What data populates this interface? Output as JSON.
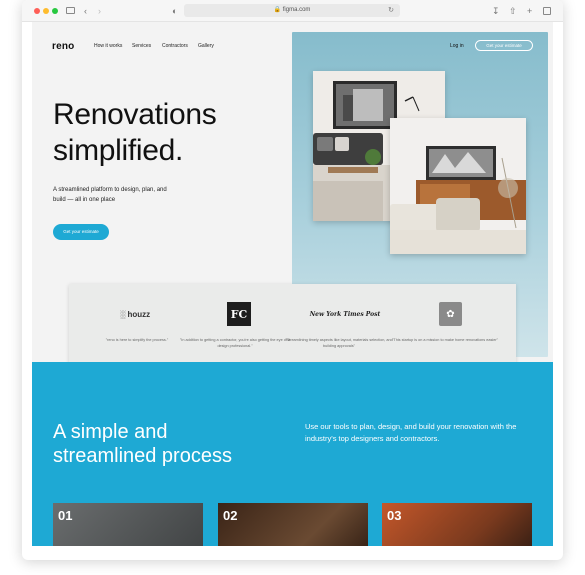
{
  "browser": {
    "url": "figma.com"
  },
  "nav": {
    "logo": "reno",
    "links": [
      "How it works",
      "Services",
      "Contractors",
      "Gallery"
    ],
    "login": "Log in",
    "cta": "Get your estimate"
  },
  "hero": {
    "title_line1": "Renovations",
    "title_line2": "simplified.",
    "subtitle": "A streamlined platform to design, plan, and build — all in one place",
    "cta": "Get your estimate"
  },
  "press": {
    "logos": [
      "houzz",
      "FC",
      "New York Times Post",
      "badge"
    ],
    "quotes": [
      "\"reno is here to simplify the process.\"",
      "\"In addition to getting a contractor, you're also getting the eye of a design professional.\"",
      "\"Streamlining timely aspects like layout, materials selection, and building approvals\"",
      "\"This startup is on a mission to make home renovations easier\""
    ]
  },
  "process": {
    "title_line1": "A simple and",
    "title_line2": "streamlined process",
    "description": "Use our tools to plan, design, and build your renovation with the industry's top designers and contractors.",
    "steps": [
      "01",
      "02",
      "03"
    ]
  },
  "colors": {
    "accent": "#1ea9d4",
    "hero_panel": "#a9d0dc"
  }
}
